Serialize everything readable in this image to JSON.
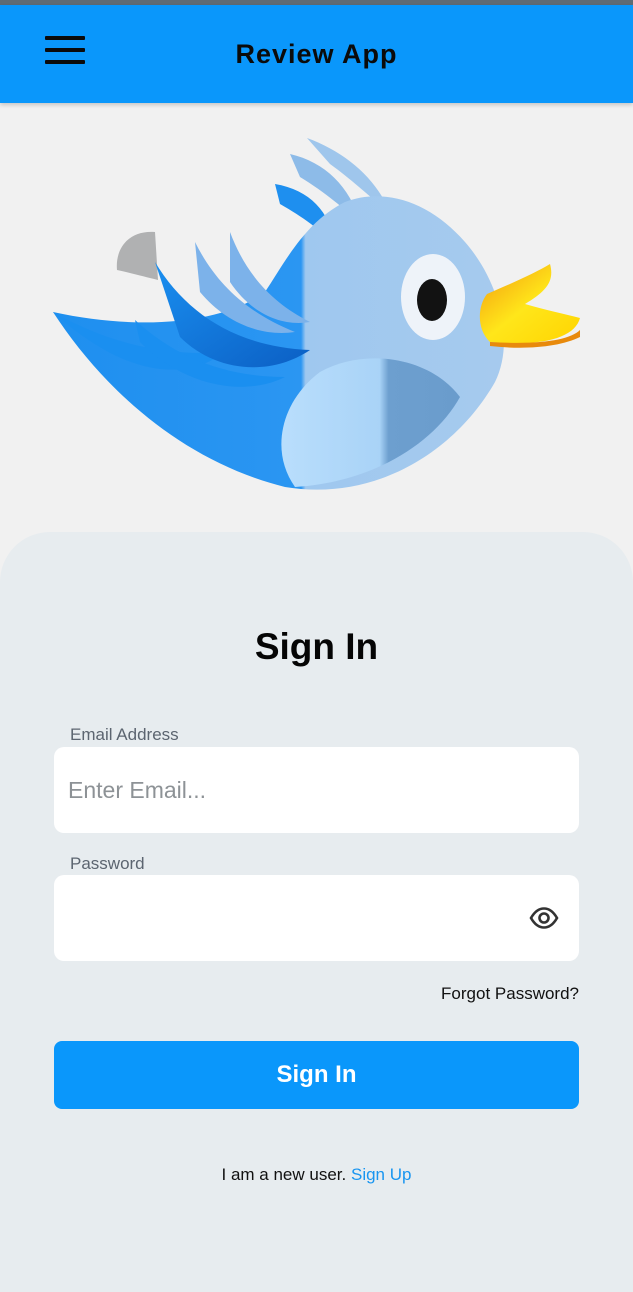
{
  "header": {
    "title": "Review App",
    "menu_icon": "hamburger-menu-icon",
    "color": "#0a97fb"
  },
  "logo": {
    "icon": "bird-logo-icon"
  },
  "signin_card": {
    "title": "Sign In",
    "email": {
      "label": "Email Address",
      "placeholder": "Enter Email...",
      "value": ""
    },
    "password": {
      "label": "Password",
      "value": "",
      "toggle_icon": "eye-icon"
    },
    "forgot_password": "Forgot Password?",
    "submit_label": "Sign In",
    "new_user_text": "I am a new user.",
    "signup_link": "Sign Up"
  },
  "colors": {
    "accent": "#0a97fb",
    "card_bg": "#e7ecef",
    "page_bg": "#f1f1f1",
    "link": "#1895f0"
  }
}
